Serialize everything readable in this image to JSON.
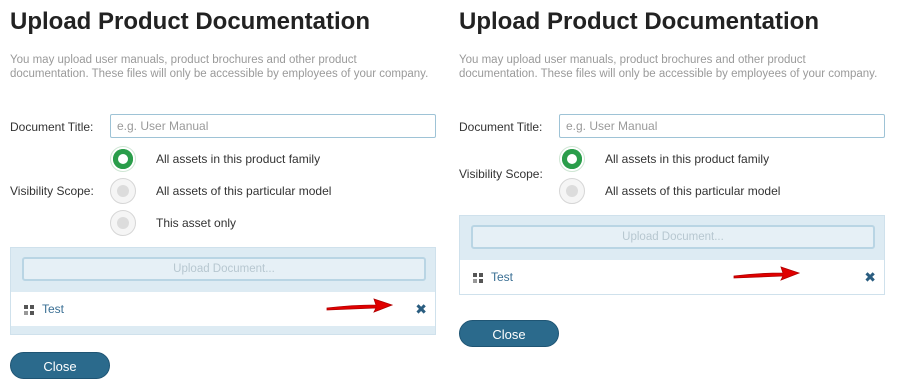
{
  "panels": [
    {
      "title": "Upload Product Documentation",
      "description": "You may upload user manuals, product brochures and other product documentation. These files will only be accessible by employees of your company.",
      "document_title_label": "Document Title:",
      "document_title_placeholder": "e.g. User Manual",
      "document_title_value": "",
      "visibility_label": "Visibility Scope:",
      "visibility_options": [
        {
          "label": "All assets in this product family",
          "selected": true
        },
        {
          "label": "All assets of this particular model",
          "selected": false
        },
        {
          "label": "This asset only",
          "selected": false
        }
      ],
      "upload_button_label": "Upload Document...",
      "files": [
        {
          "name": "Test",
          "icon": "file-grid-icon",
          "remove_icon": "close-x-icon"
        }
      ],
      "close_label": "Close"
    },
    {
      "title": "Upload Product Documentation",
      "description": "You may upload user manuals, product brochures and other product documentation. These files will only be accessible by employees of your company.",
      "document_title_label": "Document Title:",
      "document_title_placeholder": "e.g. User Manual",
      "document_title_value": "",
      "visibility_label": "Visibility Scope:",
      "visibility_options": [
        {
          "label": "All assets in this product family",
          "selected": true
        },
        {
          "label": "All assets of this particular model",
          "selected": false
        }
      ],
      "upload_button_label": "Upload Document...",
      "files": [
        {
          "name": "Test",
          "icon": "file-grid-icon",
          "remove_icon": "close-x-icon"
        }
      ],
      "close_label": "Close"
    }
  ],
  "colors": {
    "radio_selected": "#2a9d4a",
    "close_button": "#2b6a8c",
    "annotation_arrow": "#e00000",
    "link_text": "#3a6f94"
  },
  "annotations": [
    {
      "type": "red-arrow",
      "points_to": "remove-file-icon"
    }
  ]
}
